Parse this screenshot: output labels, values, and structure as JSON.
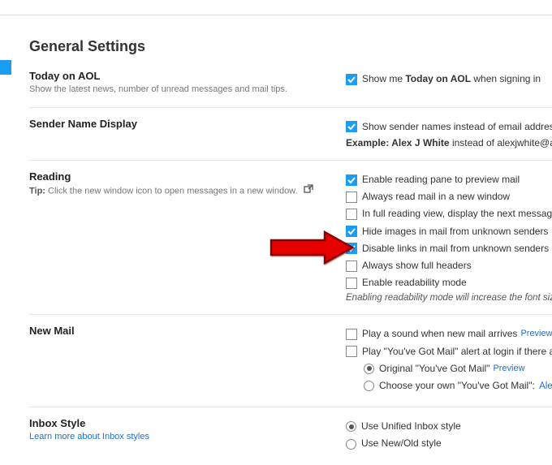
{
  "page_title": "General Settings",
  "sections": {
    "today": {
      "title": "Today on AOL",
      "sub": "Show the latest news, number of unread messages and mail tips.",
      "opt_label_pre": "Show me ",
      "opt_label_bold": "Today on AOL",
      "opt_label_post": " when signing in"
    },
    "sender": {
      "title": "Sender Name Display",
      "opt_label": "Show sender names instead of email addresses i",
      "example_label": "Example:",
      "example_bold": "Alex J White",
      "example_rest": " instead of alexjwhite@aol.co"
    },
    "reading": {
      "title": "Reading",
      "tip_label": "Tip:",
      "tip_text": " Click the new window icon to open messages in a new window.",
      "opts": [
        {
          "label": "Enable reading pane to preview mail",
          "checked": true
        },
        {
          "label": "Always read mail in a new window",
          "checked": false
        },
        {
          "label": "In full reading view, display the next message aft",
          "checked": false
        },
        {
          "label": "Hide images in mail from unknown senders",
          "checked": true
        },
        {
          "label": "Disable links in mail from unknown senders",
          "checked": true
        },
        {
          "label": "Always show full headers",
          "checked": false
        },
        {
          "label": "Enable readability mode",
          "checked": false
        }
      ],
      "note": "Enabling readability mode will increase the font size"
    },
    "newmail": {
      "title": "New Mail",
      "opt1": "Play a sound when new mail arrives",
      "opt2": "Play \"You've Got Mail\" alert at login if there are ne",
      "preview": "Preview",
      "radio1": "Original \"You've Got Mail\"",
      "radio2_pre": "Choose your own \"You've Got Mail\": ",
      "radio2_author": "Alexis B"
    },
    "inbox": {
      "title": "Inbox Style",
      "learn": "Learn more about Inbox styles",
      "opt1": "Use Unified Inbox style",
      "opt2": "Use New/Old style"
    }
  }
}
